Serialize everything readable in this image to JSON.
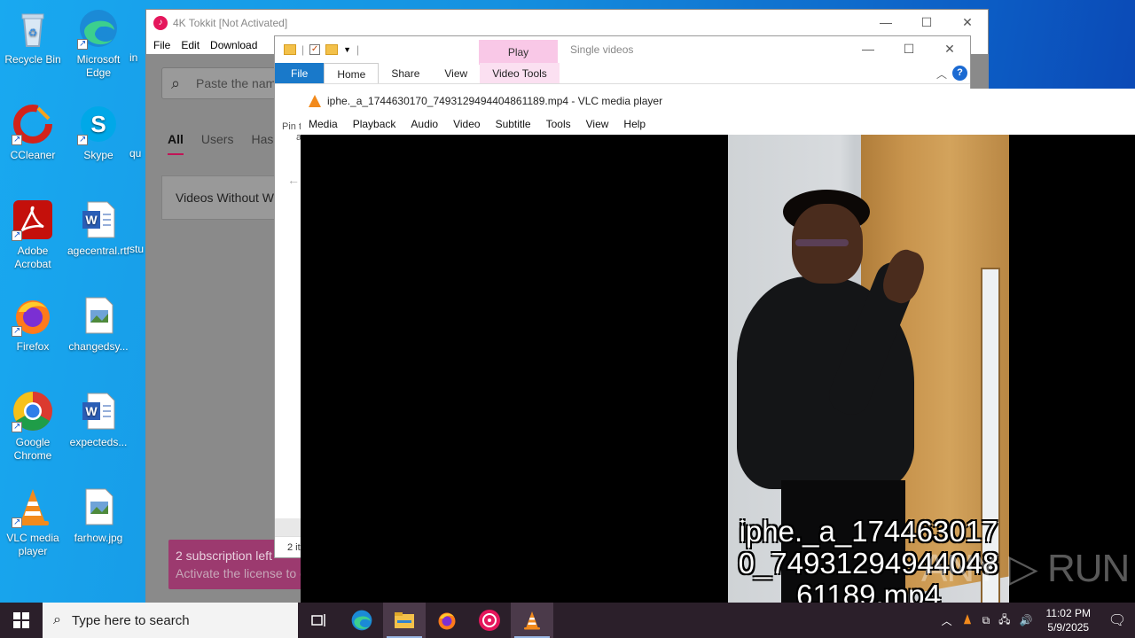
{
  "desktop": {
    "icons": [
      {
        "label": "Recycle Bin",
        "icon": "recycle-bin-icon"
      },
      {
        "label": "Microsoft Edge",
        "icon": "edge-icon"
      },
      {
        "label": "CCleaner",
        "icon": "ccleaner-icon"
      },
      {
        "label": "Skype",
        "icon": "skype-icon"
      },
      {
        "label": "Adobe Acrobat",
        "icon": "acrobat-icon"
      },
      {
        "label": "agecentral.rtf",
        "icon": "word-doc-icon"
      },
      {
        "label": "Firefox",
        "icon": "firefox-icon"
      },
      {
        "label": "changedsy...",
        "icon": "image-file-icon"
      },
      {
        "label": "Google Chrome",
        "icon": "chrome-icon"
      },
      {
        "label": "expecteds...",
        "icon": "word-doc-icon"
      },
      {
        "label": "VLC media player",
        "icon": "vlc-icon"
      },
      {
        "label": "farhow.jpg",
        "icon": "image-file-icon"
      }
    ],
    "partial_labels": [
      "in",
      "qu",
      "stu"
    ]
  },
  "tokkit": {
    "title": "4K Tokkit [Not Activated]",
    "menu": [
      "File",
      "Edit",
      "Download"
    ],
    "search_placeholder": "Paste the name",
    "tabs": [
      "All",
      "Users",
      "Hash"
    ],
    "card_label": "Videos Without W",
    "subscription_line1": "2 subscription left",
    "subscription_line2": "Activate the license to c"
  },
  "explorer": {
    "play_tab": "Play",
    "title": "Single videos",
    "ribbon_tabs": [
      "File",
      "Home",
      "Share",
      "View",
      "Video Tools"
    ],
    "pin_label": "Pin t",
    "pin_label2": "a",
    "status": "2 it"
  },
  "vlc": {
    "title": "iphe._a_1744630170_7493129494404861189.mp4 - VLC media player",
    "menu": [
      "Media",
      "Playback",
      "Audio",
      "Video",
      "Subtitle",
      "Tools",
      "View",
      "Help"
    ],
    "subtitle_lines": [
      "iphe._a_174463017",
      "0_74931294944048",
      "61189.mp4"
    ],
    "watermark": "ANY ▷ RUN"
  },
  "taskbar": {
    "search_placeholder": "Type here to search",
    "time": "11:02 PM",
    "date": "5/9/2025",
    "apps": [
      "task-view-icon",
      "edge-icon",
      "file-explorer-icon",
      "firefox-icon",
      "tokkit-icon",
      "vlc-icon"
    ]
  },
  "colors": {
    "tokkit_accent": "#c21456",
    "explorer_file_tab": "#1979ca",
    "video_tools_tab": "#f9c8e7",
    "vlc_orange": "#f28a1c",
    "taskbar": "#2b1f2a"
  }
}
